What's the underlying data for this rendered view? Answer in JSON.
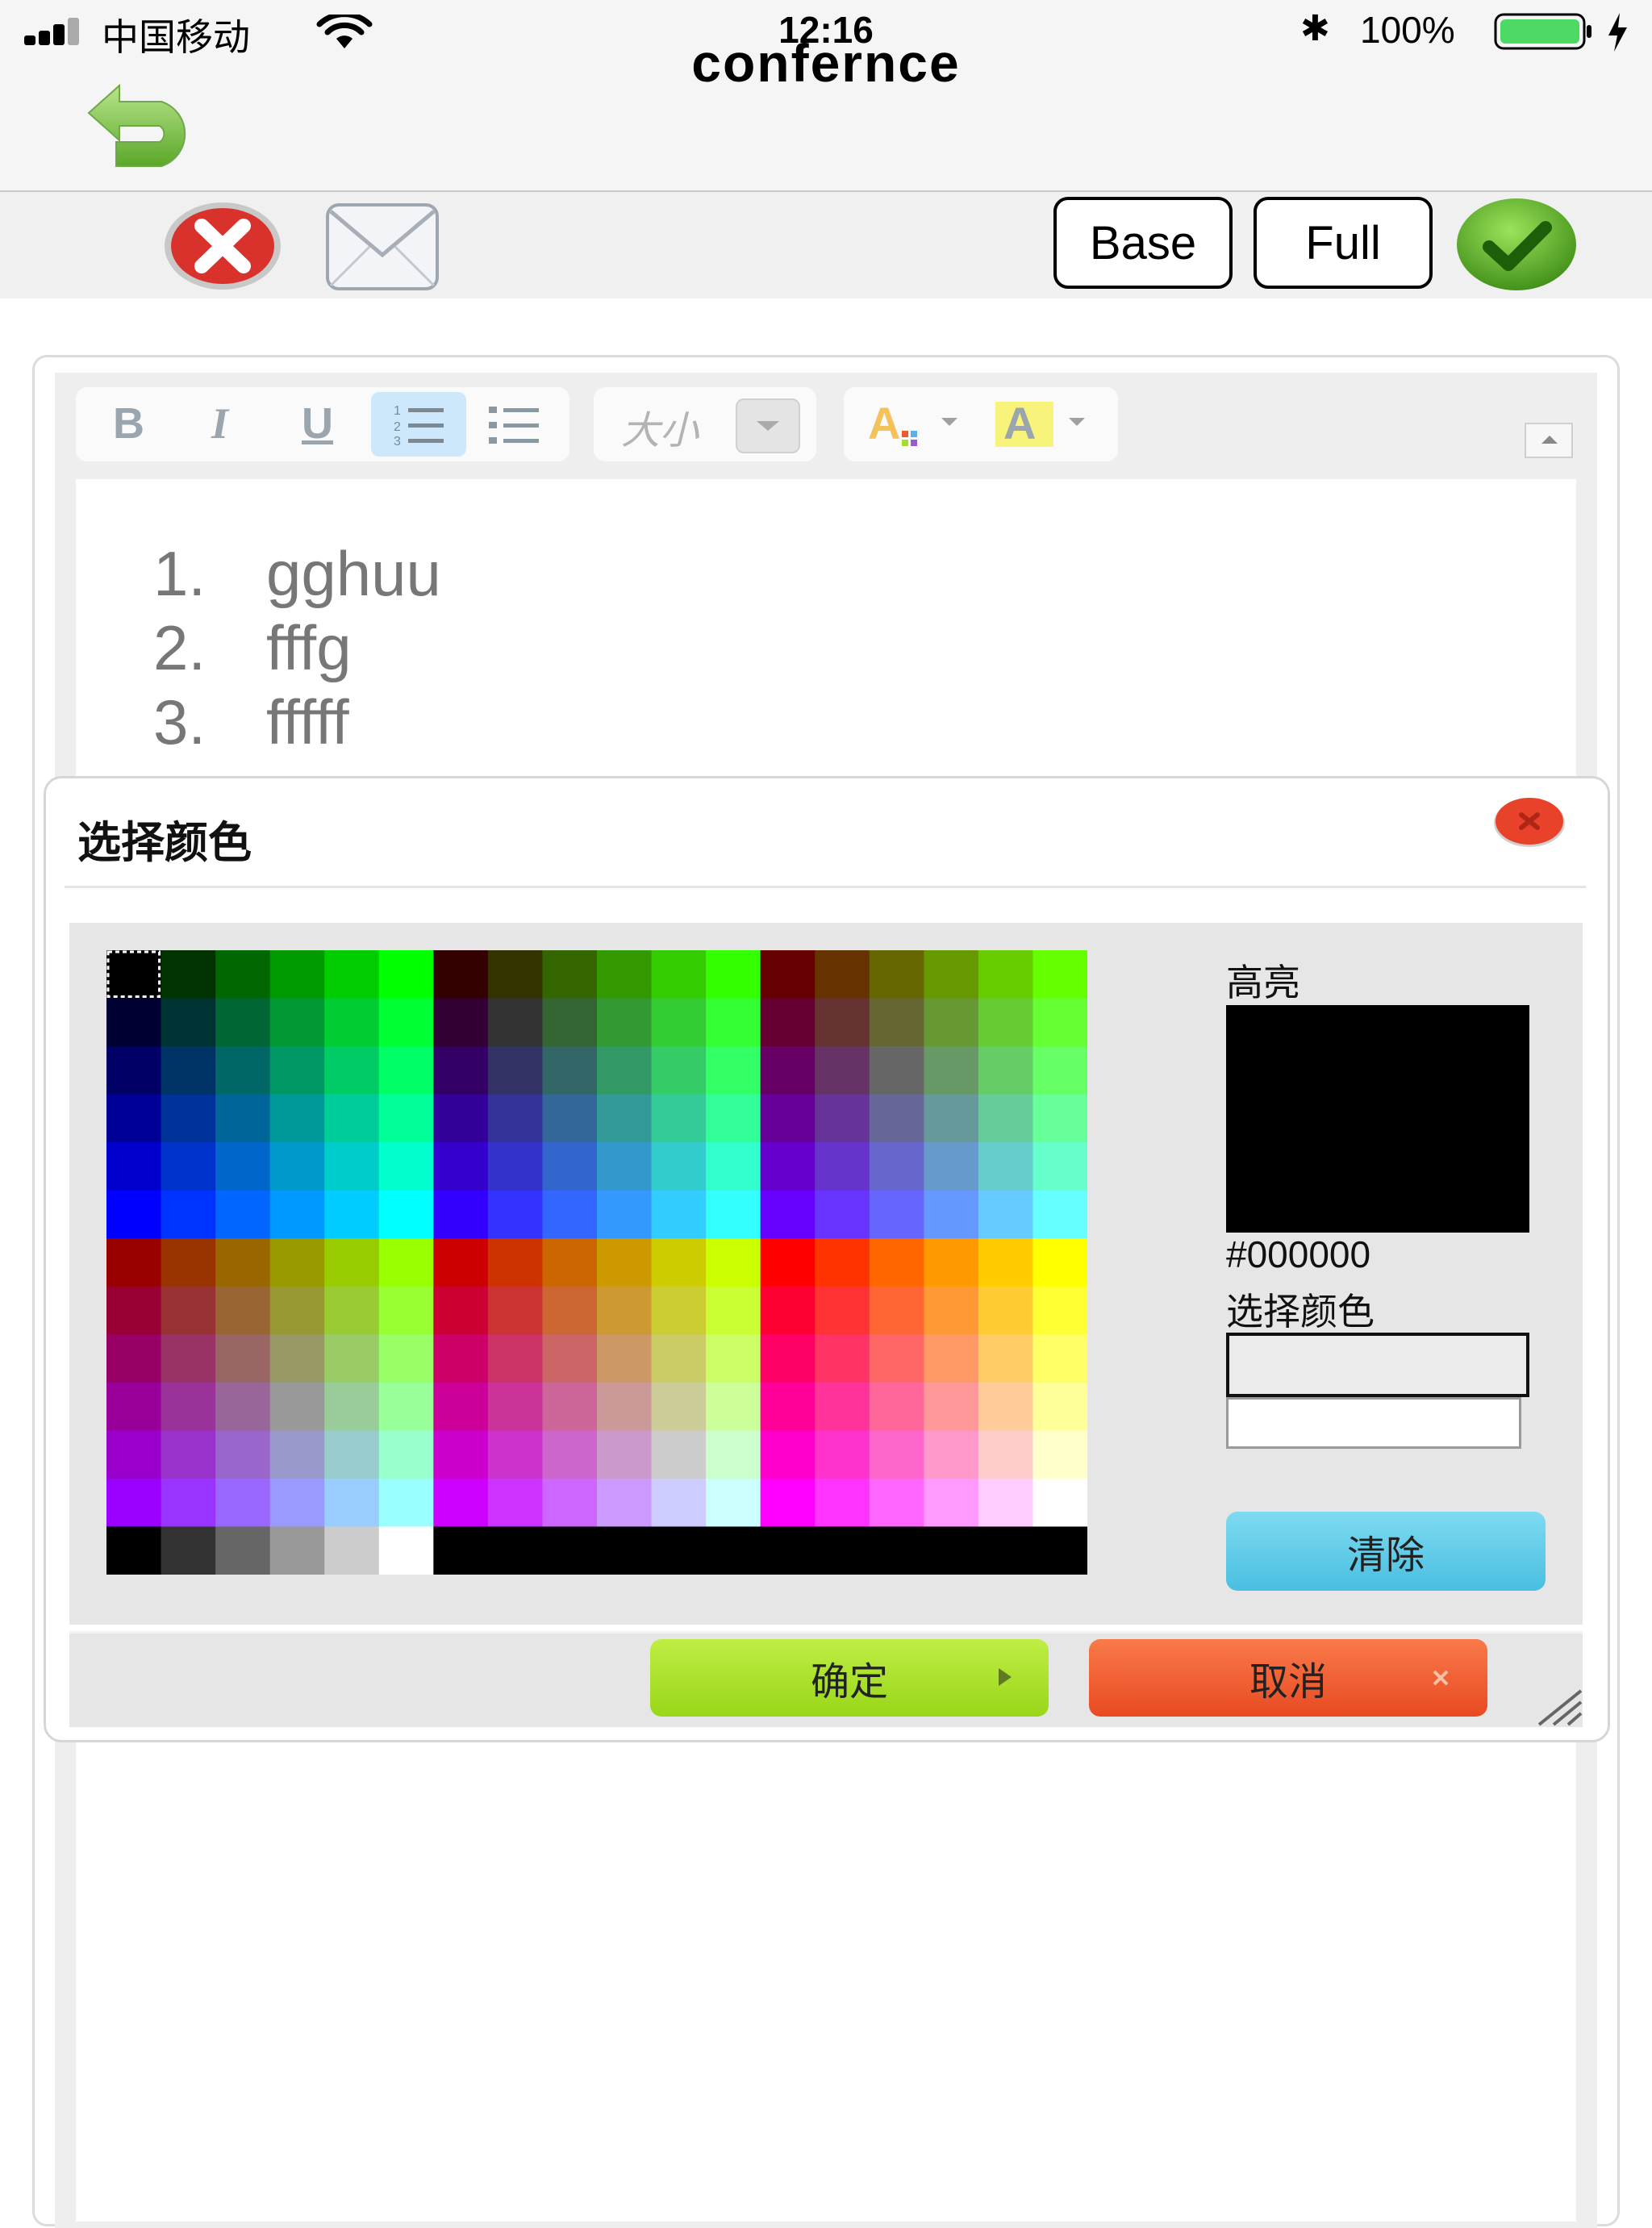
{
  "status_bar": {
    "carrier": "中国移动",
    "time": "12:16",
    "battery": "100%"
  },
  "nav": {
    "title": "confernce"
  },
  "toolbar": {
    "base_label": "Base",
    "full_label": "Full"
  },
  "editor": {
    "size_placeholder": "大小",
    "items": [
      {
        "num": "1.",
        "text": "gghuu"
      },
      {
        "num": "2.",
        "text": "fffg"
      },
      {
        "num": "3.",
        "text": "fffff"
      }
    ]
  },
  "dialog": {
    "title": "选择颜色",
    "highlight_label": "高亮",
    "preview_color": "#000000",
    "hex_value": "#000000",
    "select_label": "选择颜色",
    "clear_label": "清除",
    "ok_label": "确定",
    "cancel_label": "取消"
  },
  "colors": {
    "clear_button": "#5bcbe8",
    "ok_button": "#a3de2a",
    "cancel_button": "#ee5a30",
    "battery_fill": "#4cd964"
  }
}
